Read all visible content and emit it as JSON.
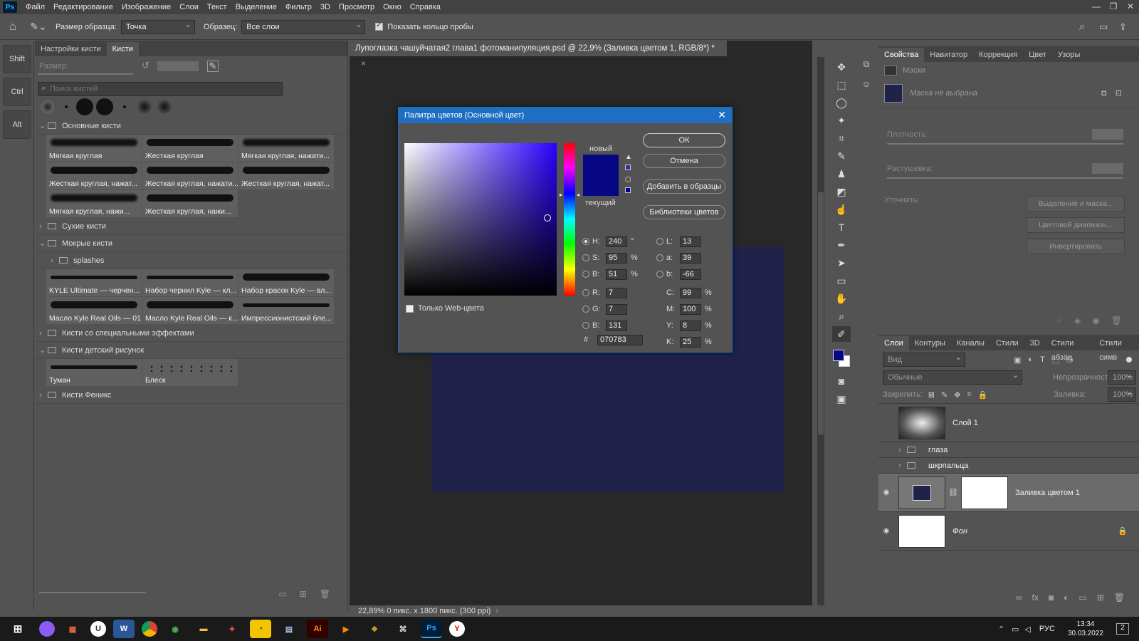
{
  "app": {
    "logo": "Ps",
    "menu": [
      "Файл",
      "Редактирование",
      "Изображение",
      "Слои",
      "Текст",
      "Выделение",
      "Фильтр",
      "3D",
      "Просмотр",
      "Окно",
      "Справка"
    ]
  },
  "options": {
    "sample_size_label": "Размер образца:",
    "sample_size_value": "Точка",
    "sample_label": "Образец:",
    "sample_value": "Все слои",
    "show_ring_label": "Показать кольцо пробы"
  },
  "modifiers": [
    "Shift",
    "Ctrl",
    "Alt"
  ],
  "brushes": {
    "tabs": [
      "Настройки кисти",
      "Кисти"
    ],
    "size_label": "Размер:",
    "search_placeholder": "Поиск кистей",
    "groups": [
      {
        "name": "Основные кисти",
        "open": true,
        "items": [
          {
            "label": "Мягкая круглая",
            "s": "soft"
          },
          {
            "label": "Жесткая круглая",
            "s": "hard"
          },
          {
            "label": "Мягкая круглая, нажати...",
            "s": "soft"
          },
          {
            "label": "Жесткая круглая, нажат...",
            "s": "hard"
          },
          {
            "label": "Жесткая круглая, нажати...",
            "s": "hard"
          },
          {
            "label": "Жесткая круглая, нажат...",
            "s": "hard"
          },
          {
            "label": "Мягкая круглая, нажи...",
            "s": "soft"
          },
          {
            "label": "Жесткая круглая, нажи...",
            "s": "hard"
          }
        ]
      },
      {
        "name": "Сухие кисти",
        "open": false,
        "items": []
      },
      {
        "name": "Мокрые кисти",
        "open": true,
        "sub": "splashes",
        "items": [
          {
            "label": "KYLE Ultimate — черчен...",
            "s": "thin"
          },
          {
            "label": "Набор чернил Kyle — кл...",
            "s": "thin"
          },
          {
            "label": "Набор красок Kyle — вл...",
            "s": "hard"
          },
          {
            "label": "Масло Kyle Real Oils — 01",
            "s": "hard"
          },
          {
            "label": "Масло Kyle Real Oils — к...",
            "s": "hard"
          },
          {
            "label": "Импрессионистский бле...",
            "s": "thin"
          }
        ]
      },
      {
        "name": "Кисти со специальными эффектами",
        "open": false,
        "items": []
      },
      {
        "name": "Кисти детский рисунок",
        "open": true,
        "items": [
          {
            "label": "Туман",
            "s": "thin"
          },
          {
            "label": "Блеск",
            "s": "dots"
          }
        ]
      },
      {
        "name": "Кисти Феникс",
        "open": false,
        "items": []
      }
    ]
  },
  "document": {
    "tab": "Лупоглазка чашуйчатая2 глава1 фотоманипуляция.psd @ 22,9% (Заливка цветом 1, RGB/8*) *",
    "status": "22,89%",
    "status_info": "0 пикс. x 1800 пикс. (300 ppi)",
    "artboard_color": "#20224a"
  },
  "dialog": {
    "title": "Палитра цветов (Основной цвет)",
    "new_label": "новый",
    "current_label": "текущий",
    "ok": "ОК",
    "cancel": "Отмена",
    "add_swatch": "Добавить в образцы",
    "libraries": "Библиотеки цветов",
    "web_only": "Только Web-цвета",
    "color": "#070783",
    "hsb": [
      {
        "l": "H:",
        "v": "240",
        "u": "°"
      },
      {
        "l": "S:",
        "v": "95",
        "u": "%"
      },
      {
        "l": "B:",
        "v": "51",
        "u": "%"
      }
    ],
    "rgb": [
      {
        "l": "R:",
        "v": "7"
      },
      {
        "l": "G:",
        "v": "7"
      },
      {
        "l": "B:",
        "v": "131"
      }
    ],
    "lab": [
      {
        "l": "L:",
        "v": "13"
      },
      {
        "l": "a:",
        "v": "39"
      },
      {
        "l": "b:",
        "v": "-66"
      }
    ],
    "cmyk": [
      {
        "l": "C:",
        "v": "99",
        "u": "%"
      },
      {
        "l": "M:",
        "v": "100",
        "u": "%"
      },
      {
        "l": "Y:",
        "v": "8",
        "u": "%"
      },
      {
        "l": "K:",
        "v": "25",
        "u": "%"
      }
    ],
    "hex_label": "#",
    "hex": "070783"
  },
  "properties": {
    "tabs": [
      "Свойства",
      "Навигатор",
      "Коррекция",
      "Цвет",
      "Узоры"
    ],
    "section": "Маски",
    "mask_none": "Маска не выбрана",
    "density": "Плотность:",
    "feather": "Растушевка:",
    "refine": "Уточнить:",
    "btn_select": "Выделение и маска...",
    "btn_range": "Цветовой диапазон...",
    "btn_invert": "Инвертировать"
  },
  "layers": {
    "tabs": [
      "Слои",
      "Контуры",
      "Каналы",
      "Стили",
      "3D",
      "Стили абзац",
      "Стили симв"
    ],
    "filter": "Вид",
    "blend": "Обычные",
    "opacity_label": "Непрозрачность:",
    "opacity": "100%",
    "lock_label": "Закрепить:",
    "fill_label": "Заливка:",
    "fill": "100%",
    "items": [
      {
        "name": "Слой 1",
        "type": "layer"
      },
      {
        "name": "глаза",
        "type": "group"
      },
      {
        "name": "шкрпальца",
        "type": "group"
      },
      {
        "name": "Заливка цветом 1",
        "type": "fill"
      },
      {
        "name": "Фон",
        "type": "bg"
      }
    ]
  },
  "taskbar": {
    "lang": "РУС",
    "time": "13:34",
    "date": "30.03.2022",
    "notif": "2"
  }
}
